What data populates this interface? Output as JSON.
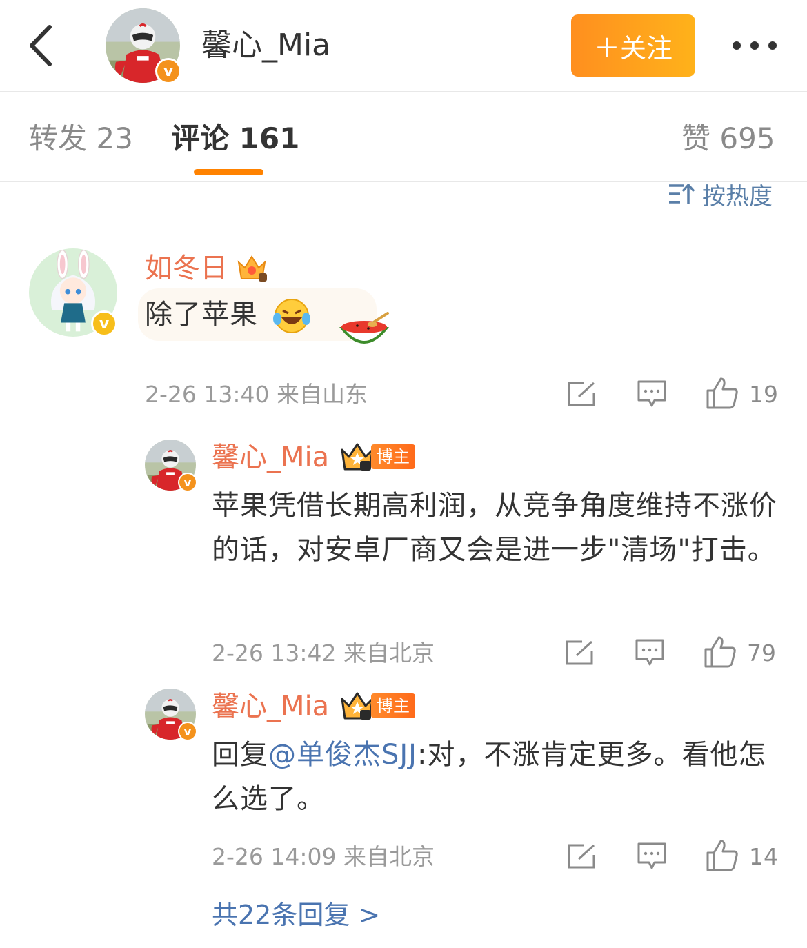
{
  "header": {
    "back_icon": "chevron-left-icon",
    "author_name": "馨心_Mia",
    "follow_label": "＋关注",
    "more_icon": "more-dots-icon"
  },
  "tabs": {
    "repost": "转发 23",
    "comment": "评论 161",
    "like": "赞 695"
  },
  "sort": {
    "label": "按热度",
    "icon": "sort-icon"
  },
  "comments": [
    {
      "name": "如冬日",
      "badge_icon": "crown-7-icon",
      "text": "除了苹果",
      "emoji": "laugh-cry-emoji",
      "sticker": "watermelon-sticker",
      "time": "2-26 13:40 来自山东",
      "likes": "19"
    },
    {
      "name": "馨心_Mia",
      "badge_icon": "crown-2-icon",
      "tag": "博主",
      "text": "苹果凭借长期高利润，从竞争角度维持不涨价的话，对安卓厂商又会是进一步\"清场\"打击。",
      "time": "2-26 13:42 来自北京",
      "likes": "79"
    },
    {
      "name": "馨心_Mia",
      "badge_icon": "crown-2-icon",
      "tag": "博主",
      "reply_prefix": "回复",
      "mention": "@单俊杰SJJ",
      "text": ":对，不涨肯定更多。看他怎么选了。",
      "time": "2-26 14:09 来自北京",
      "likes": "14"
    }
  ],
  "more_replies": "共22条回复 >",
  "colors": {
    "accent": "#ff8200",
    "name": "#eb7350",
    "link": "#4a74b0",
    "muted": "#9a9a9a"
  }
}
